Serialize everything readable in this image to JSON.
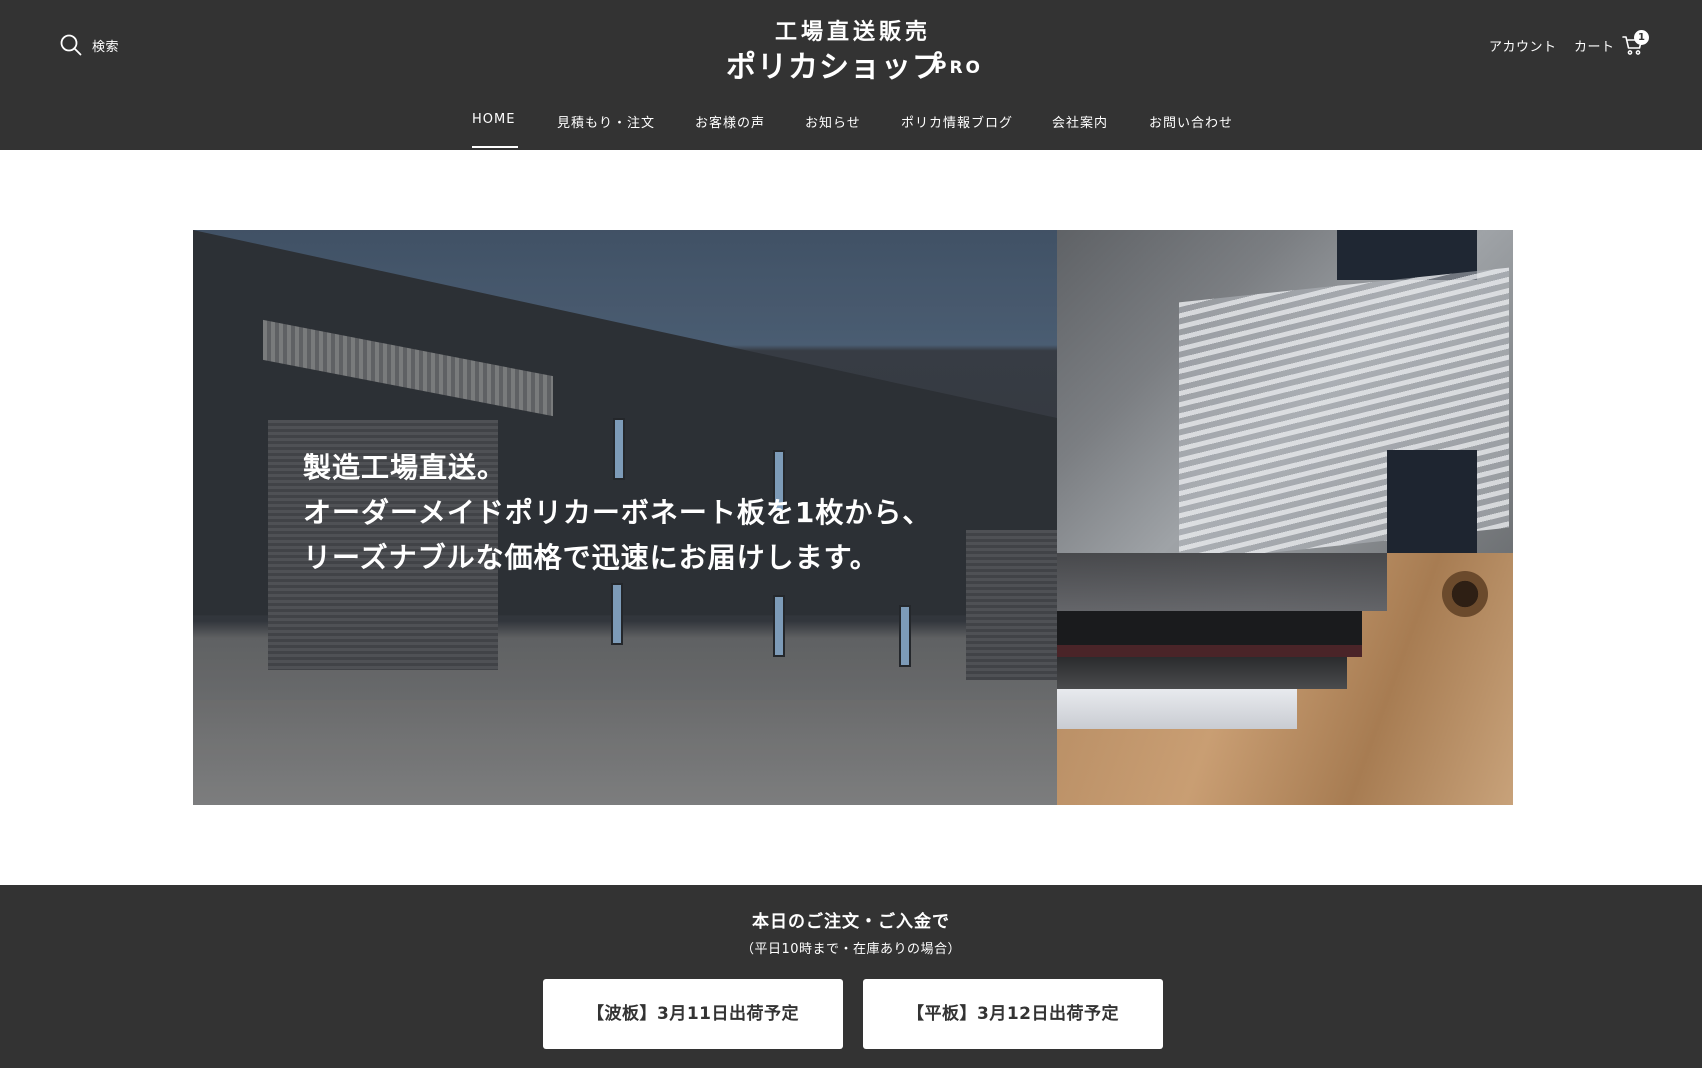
{
  "header": {
    "search_label": "検索",
    "logo_top": "工場直送販売",
    "logo_main": "ポリカショップ",
    "logo_suffix": "PRO",
    "account_label": "アカウント",
    "cart_label": "カート",
    "cart_count": "1"
  },
  "nav": {
    "items": [
      {
        "label": "HOME",
        "active": true
      },
      {
        "label": "見積もり・注文",
        "active": false
      },
      {
        "label": "お客様の声",
        "active": false
      },
      {
        "label": "お知らせ",
        "active": false
      },
      {
        "label": "ポリカ情報ブログ",
        "active": false
      },
      {
        "label": "会社案内",
        "active": false
      },
      {
        "label": "お問い合わせ",
        "active": false
      }
    ]
  },
  "hero": {
    "lines": [
      "製造工場直送。",
      "オーダーメイドポリカーボネート板を1枚から、",
      "リーズナブルな価格で迅速にお届けします。"
    ]
  },
  "shipping": {
    "title": "本日のご注文・ご入金で",
    "subtitle": "（平日10時まで・在庫ありの場合）",
    "buttons": [
      {
        "label": "【波板】3月11日出荷予定"
      },
      {
        "label": "【平板】3月12日出荷予定"
      }
    ]
  },
  "colors": {
    "header_bg": "#333333",
    "text_light": "#ffffff",
    "button_bg": "#ffffff",
    "button_text": "#333333"
  }
}
